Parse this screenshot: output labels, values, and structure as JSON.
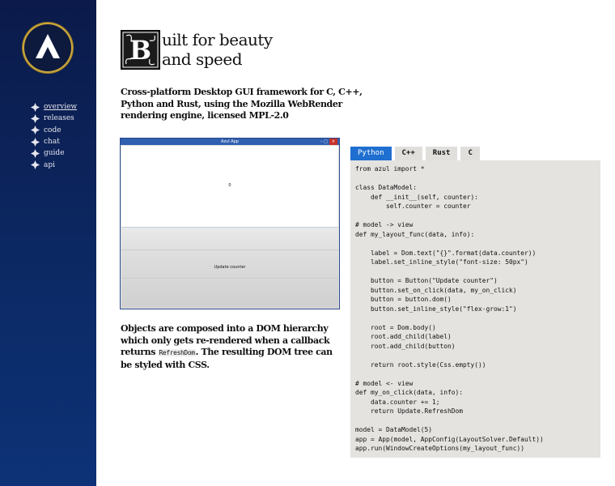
{
  "nav": {
    "items": [
      {
        "label": "overview"
      },
      {
        "label": "releases"
      },
      {
        "label": "code"
      },
      {
        "label": "chat"
      },
      {
        "label": "guide"
      },
      {
        "label": "api"
      }
    ]
  },
  "headline": {
    "dropcap_letter": "B",
    "line1": "uilt for beauty",
    "line2": "and speed"
  },
  "intro": "Cross-platform Desktop GUI framework for C, C++, Python and Rust, using the Mozilla WebRender rendering engine, licensed MPL-2.0",
  "app_window": {
    "title": "Azul App",
    "counter": "0",
    "button_label": "Update counter"
  },
  "description": {
    "part1": "Objects are composed into a DOM hierarchy which only gets re-rendered when a callback returns ",
    "code": "RefreshDom",
    "part2": ". The resulting DOM tree can be styled with CSS."
  },
  "tabs": [
    {
      "label": "Python",
      "active": true
    },
    {
      "label": "C++",
      "active": false
    },
    {
      "label": "Rust",
      "active": false
    },
    {
      "label": "C",
      "active": false
    }
  ],
  "code": "from azul import *\n\nclass DataModel:\n    def __init__(self, counter):\n        self.counter = counter\n\n# model -> view\ndef my_layout_func(data, info):\n\n    label = Dom.text(\"{}\".format(data.counter))\n    label.set_inline_style(\"font-size: 50px\")\n\n    button = Button(\"Update counter\")\n    button.set_on_click(data, my_on_click)\n    button = button.dom()\n    button.set_inline_style(\"flex-grow:1\")\n\n    root = Dom.body()\n    root.add_child(label)\n    root.add_child(button)\n\n    return root.style(Css.empty())\n\n# model <- view\ndef my_on_click(data, info):\n    data.counter += 1;\n    return Update.RefreshDom\n\nmodel = DataModel(5)\napp = App(model, AppConfig(LayoutSolver.Default))\napp.run(WindowCreateOptions(my_layout_func))",
  "colors": {
    "sidebar": "#0c2a66",
    "tab_active": "#1f6fd1",
    "code_bg": "#e4e3e0",
    "logo_ring": "#c9a63f"
  },
  "icons": {
    "logo": "azul-logo-icon",
    "nav_bullet": "cross-bullet-icon"
  }
}
